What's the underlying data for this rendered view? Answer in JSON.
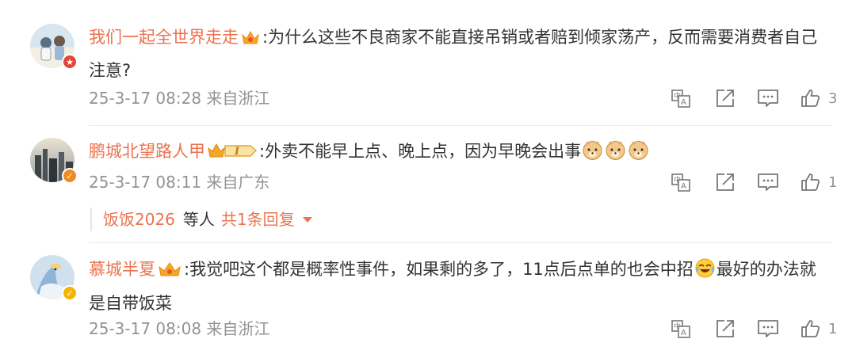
{
  "comments": [
    {
      "author": "我们一起全世界走走",
      "content": ":为什么这些不良商家不能直接吊销或者赔到倾家荡产，反而需要消费者自己注意?",
      "time": "25-3-17 08:28 来自浙江",
      "likes": "3",
      "badge_color": "#e0463a"
    },
    {
      "author": "鹏城北望路人甲",
      "content": ":外卖不能早上点、晚上点，因为早晚会出事",
      "level_badge": "I",
      "time": "25-3-17 08:11 来自广东",
      "likes": "1",
      "badge_color": "#f08a24",
      "replies": {
        "who": "饭饭2026",
        "etc": "等人",
        "total": "共1条回复"
      }
    },
    {
      "author": "慕城半夏",
      "content_part1": ":我觉吧这个都是概率性事件，如果剩的多了，11点后点单的也会中招",
      "content_part2": "最好的办法就是自带饭菜",
      "time": "25-3-17 08:08 来自浙江",
      "likes": "1",
      "badge_color": "#f5b400"
    }
  ],
  "icons": {
    "translate": "translate-icon",
    "share": "share-icon",
    "comment": "comment-icon",
    "like": "thumbs-up-icon"
  }
}
